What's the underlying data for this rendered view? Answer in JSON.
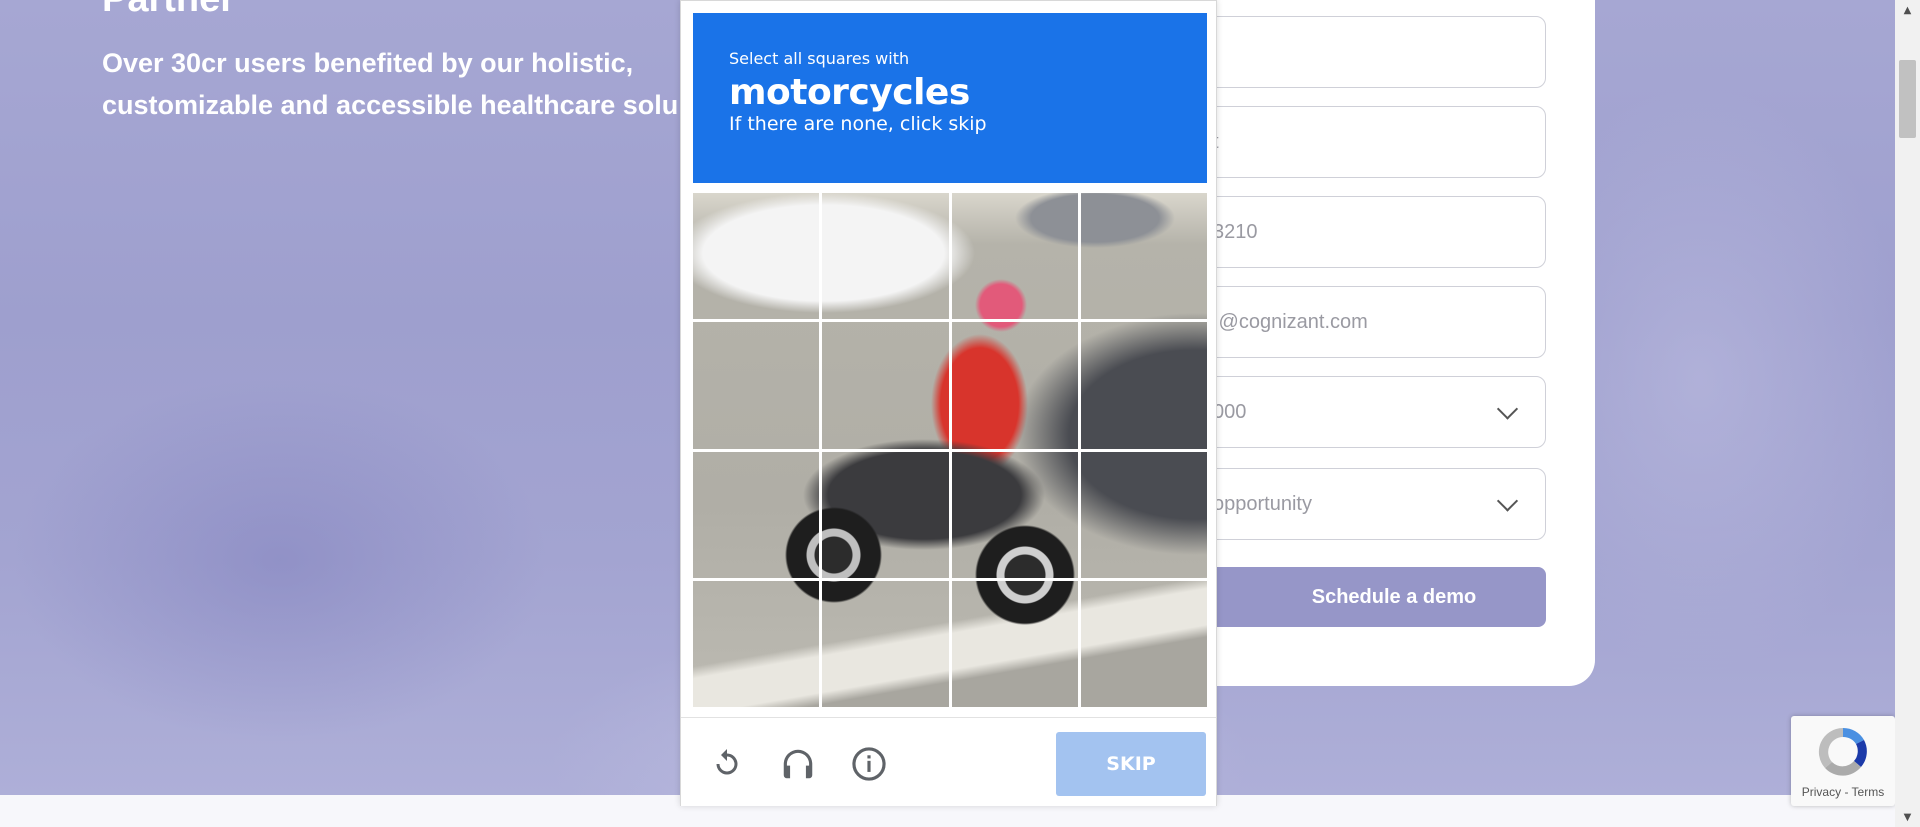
{
  "hero": {
    "headline_partial": "Partner",
    "subline": "Over 30cr users benefited by our holistic, customizable and accessible healthcare solu"
  },
  "form": {
    "fields": [
      {
        "value": ""
      },
      {
        "value": "t"
      },
      {
        "value": "3210"
      },
      {
        "value": ".@cognizant.com"
      },
      {
        "value": "000",
        "has_dropdown": true
      },
      {
        "value": " opportunity",
        "has_dropdown": true
      }
    ],
    "submit_label": "Schedule a demo"
  },
  "captcha": {
    "instruction_line1": "Select all squares with",
    "object": "motorcycles",
    "instruction_line3": "If there are none, click skip",
    "grid_rows": 4,
    "grid_cols": 4,
    "icons": [
      "reload-icon",
      "audio-headphones-icon",
      "info-icon"
    ],
    "skip_label": "SKIP",
    "header_color": "#1a73e8"
  },
  "recaptcha_badge": {
    "links": "Privacy - Terms"
  },
  "colors": {
    "page_bg": "#a3a4d1",
    "button": "#9696c8",
    "skip_button": "#a3c3f0"
  }
}
